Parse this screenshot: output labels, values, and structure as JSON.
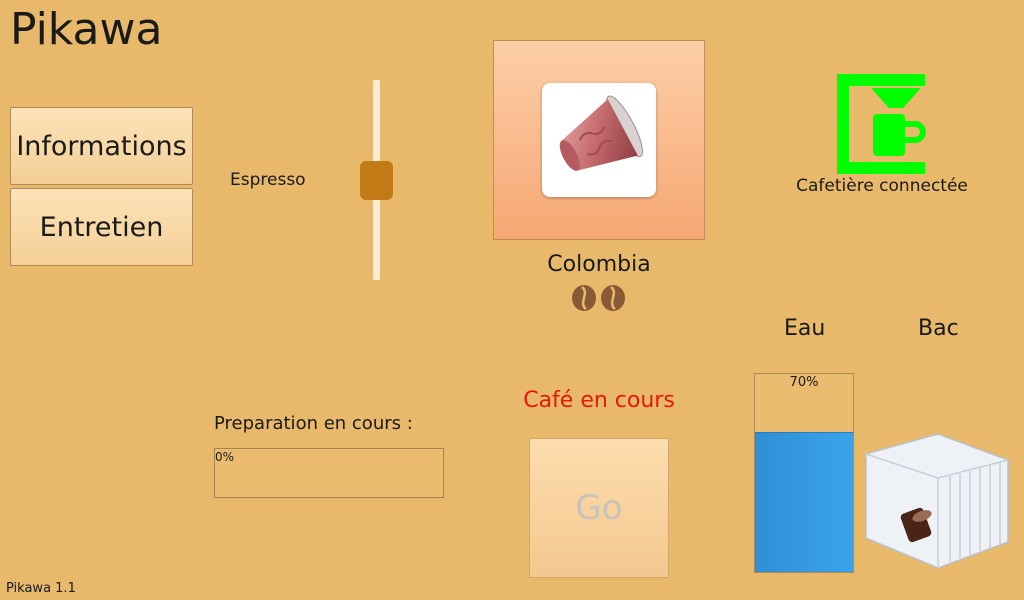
{
  "app": {
    "title": "Pikawa",
    "version": "Pikawa 1.1"
  },
  "nav": {
    "informations": "Informations",
    "entretien": "Entretien"
  },
  "beverage": {
    "label": "Espresso",
    "slider_level": 0.5
  },
  "capsule": {
    "name": "Colombia",
    "intensity": 2,
    "icon": "capsule-icon"
  },
  "connection": {
    "status": "Cafetière connectée",
    "icon": "coffee-machine-icon",
    "color": "#00ff00"
  },
  "tanks": {
    "water": {
      "label": "Eau",
      "level_text": "70%",
      "level": 0.7,
      "color": "#3aa3ea"
    },
    "tray": {
      "label": "Bac",
      "icon": "drip-tray-icon"
    }
  },
  "preparation": {
    "label": "Preparation en cours :",
    "progress_text": "0%",
    "progress": 0
  },
  "status": {
    "text": "Café en cours",
    "color": "#e8170f"
  },
  "go_button": {
    "label": "Go"
  }
}
